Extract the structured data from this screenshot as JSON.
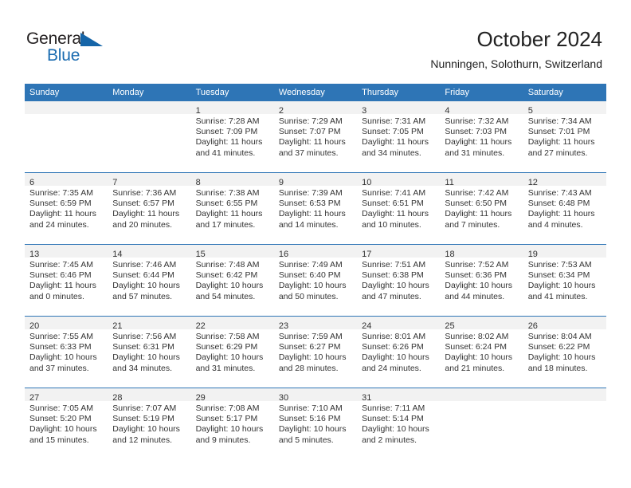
{
  "brand": {
    "name_part1": "General",
    "name_part2": "Blue",
    "flag_icon": "brand-flag-icon",
    "accent_color": "#1a6bb0"
  },
  "header": {
    "title": "October 2024",
    "subtitle": "Nunningen, Solothurn, Switzerland"
  },
  "theme": {
    "header_row_bg": "#2e75b6",
    "daynum_bar_bg": "#f2f2f2",
    "grid_line": "#2e75b6",
    "text": "#333333"
  },
  "calendar": {
    "weekday_headers": [
      "Sunday",
      "Monday",
      "Tuesday",
      "Wednesday",
      "Thursday",
      "Friday",
      "Saturday"
    ],
    "labels": {
      "sunrise_prefix": "Sunrise:",
      "sunset_prefix": "Sunset:",
      "daylight_prefix": "Daylight:"
    },
    "weeks": [
      [
        {
          "day": "",
          "empty": true
        },
        {
          "day": "",
          "empty": true
        },
        {
          "day": "1",
          "sunrise": "Sunrise: 7:28 AM",
          "sunset": "Sunset: 7:09 PM",
          "daylight_line1": "Daylight: 11 hours",
          "daylight_line2": "and 41 minutes."
        },
        {
          "day": "2",
          "sunrise": "Sunrise: 7:29 AM",
          "sunset": "Sunset: 7:07 PM",
          "daylight_line1": "Daylight: 11 hours",
          "daylight_line2": "and 37 minutes."
        },
        {
          "day": "3",
          "sunrise": "Sunrise: 7:31 AM",
          "sunset": "Sunset: 7:05 PM",
          "daylight_line1": "Daylight: 11 hours",
          "daylight_line2": "and 34 minutes."
        },
        {
          "day": "4",
          "sunrise": "Sunrise: 7:32 AM",
          "sunset": "Sunset: 7:03 PM",
          "daylight_line1": "Daylight: 11 hours",
          "daylight_line2": "and 31 minutes."
        },
        {
          "day": "5",
          "sunrise": "Sunrise: 7:34 AM",
          "sunset": "Sunset: 7:01 PM",
          "daylight_line1": "Daylight: 11 hours",
          "daylight_line2": "and 27 minutes."
        }
      ],
      [
        {
          "day": "6",
          "sunrise": "Sunrise: 7:35 AM",
          "sunset": "Sunset: 6:59 PM",
          "daylight_line1": "Daylight: 11 hours",
          "daylight_line2": "and 24 minutes."
        },
        {
          "day": "7",
          "sunrise": "Sunrise: 7:36 AM",
          "sunset": "Sunset: 6:57 PM",
          "daylight_line1": "Daylight: 11 hours",
          "daylight_line2": "and 20 minutes."
        },
        {
          "day": "8",
          "sunrise": "Sunrise: 7:38 AM",
          "sunset": "Sunset: 6:55 PM",
          "daylight_line1": "Daylight: 11 hours",
          "daylight_line2": "and 17 minutes."
        },
        {
          "day": "9",
          "sunrise": "Sunrise: 7:39 AM",
          "sunset": "Sunset: 6:53 PM",
          "daylight_line1": "Daylight: 11 hours",
          "daylight_line2": "and 14 minutes."
        },
        {
          "day": "10",
          "sunrise": "Sunrise: 7:41 AM",
          "sunset": "Sunset: 6:51 PM",
          "daylight_line1": "Daylight: 11 hours",
          "daylight_line2": "and 10 minutes."
        },
        {
          "day": "11",
          "sunrise": "Sunrise: 7:42 AM",
          "sunset": "Sunset: 6:50 PM",
          "daylight_line1": "Daylight: 11 hours",
          "daylight_line2": "and 7 minutes."
        },
        {
          "day": "12",
          "sunrise": "Sunrise: 7:43 AM",
          "sunset": "Sunset: 6:48 PM",
          "daylight_line1": "Daylight: 11 hours",
          "daylight_line2": "and 4 minutes."
        }
      ],
      [
        {
          "day": "13",
          "sunrise": "Sunrise: 7:45 AM",
          "sunset": "Sunset: 6:46 PM",
          "daylight_line1": "Daylight: 11 hours",
          "daylight_line2": "and 0 minutes."
        },
        {
          "day": "14",
          "sunrise": "Sunrise: 7:46 AM",
          "sunset": "Sunset: 6:44 PM",
          "daylight_line1": "Daylight: 10 hours",
          "daylight_line2": "and 57 minutes."
        },
        {
          "day": "15",
          "sunrise": "Sunrise: 7:48 AM",
          "sunset": "Sunset: 6:42 PM",
          "daylight_line1": "Daylight: 10 hours",
          "daylight_line2": "and 54 minutes."
        },
        {
          "day": "16",
          "sunrise": "Sunrise: 7:49 AM",
          "sunset": "Sunset: 6:40 PM",
          "daylight_line1": "Daylight: 10 hours",
          "daylight_line2": "and 50 minutes."
        },
        {
          "day": "17",
          "sunrise": "Sunrise: 7:51 AM",
          "sunset": "Sunset: 6:38 PM",
          "daylight_line1": "Daylight: 10 hours",
          "daylight_line2": "and 47 minutes."
        },
        {
          "day": "18",
          "sunrise": "Sunrise: 7:52 AM",
          "sunset": "Sunset: 6:36 PM",
          "daylight_line1": "Daylight: 10 hours",
          "daylight_line2": "and 44 minutes."
        },
        {
          "day": "19",
          "sunrise": "Sunrise: 7:53 AM",
          "sunset": "Sunset: 6:34 PM",
          "daylight_line1": "Daylight: 10 hours",
          "daylight_line2": "and 41 minutes."
        }
      ],
      [
        {
          "day": "20",
          "sunrise": "Sunrise: 7:55 AM",
          "sunset": "Sunset: 6:33 PM",
          "daylight_line1": "Daylight: 10 hours",
          "daylight_line2": "and 37 minutes."
        },
        {
          "day": "21",
          "sunrise": "Sunrise: 7:56 AM",
          "sunset": "Sunset: 6:31 PM",
          "daylight_line1": "Daylight: 10 hours",
          "daylight_line2": "and 34 minutes."
        },
        {
          "day": "22",
          "sunrise": "Sunrise: 7:58 AM",
          "sunset": "Sunset: 6:29 PM",
          "daylight_line1": "Daylight: 10 hours",
          "daylight_line2": "and 31 minutes."
        },
        {
          "day": "23",
          "sunrise": "Sunrise: 7:59 AM",
          "sunset": "Sunset: 6:27 PM",
          "daylight_line1": "Daylight: 10 hours",
          "daylight_line2": "and 28 minutes."
        },
        {
          "day": "24",
          "sunrise": "Sunrise: 8:01 AM",
          "sunset": "Sunset: 6:26 PM",
          "daylight_line1": "Daylight: 10 hours",
          "daylight_line2": "and 24 minutes."
        },
        {
          "day": "25",
          "sunrise": "Sunrise: 8:02 AM",
          "sunset": "Sunset: 6:24 PM",
          "daylight_line1": "Daylight: 10 hours",
          "daylight_line2": "and 21 minutes."
        },
        {
          "day": "26",
          "sunrise": "Sunrise: 8:04 AM",
          "sunset": "Sunset: 6:22 PM",
          "daylight_line1": "Daylight: 10 hours",
          "daylight_line2": "and 18 minutes."
        }
      ],
      [
        {
          "day": "27",
          "sunrise": "Sunrise: 7:05 AM",
          "sunset": "Sunset: 5:20 PM",
          "daylight_line1": "Daylight: 10 hours",
          "daylight_line2": "and 15 minutes."
        },
        {
          "day": "28",
          "sunrise": "Sunrise: 7:07 AM",
          "sunset": "Sunset: 5:19 PM",
          "daylight_line1": "Daylight: 10 hours",
          "daylight_line2": "and 12 minutes."
        },
        {
          "day": "29",
          "sunrise": "Sunrise: 7:08 AM",
          "sunset": "Sunset: 5:17 PM",
          "daylight_line1": "Daylight: 10 hours",
          "daylight_line2": "and 9 minutes."
        },
        {
          "day": "30",
          "sunrise": "Sunrise: 7:10 AM",
          "sunset": "Sunset: 5:16 PM",
          "daylight_line1": "Daylight: 10 hours",
          "daylight_line2": "and 5 minutes."
        },
        {
          "day": "31",
          "sunrise": "Sunrise: 7:11 AM",
          "sunset": "Sunset: 5:14 PM",
          "daylight_line1": "Daylight: 10 hours",
          "daylight_line2": "and 2 minutes."
        },
        {
          "day": "",
          "empty": true
        },
        {
          "day": "",
          "empty": true
        }
      ]
    ]
  }
}
